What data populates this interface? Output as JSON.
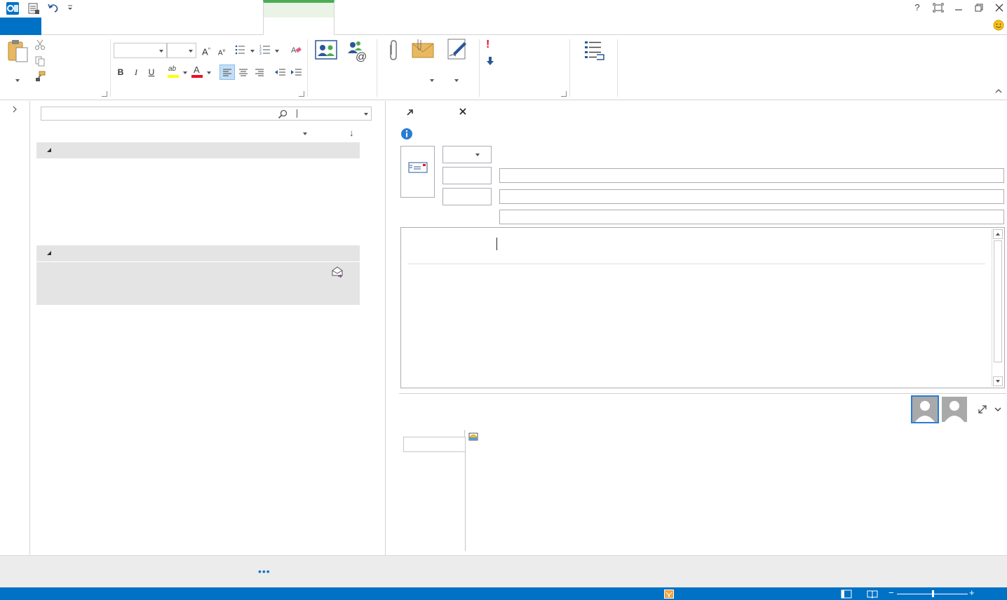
{
  "window": {
    "title": "",
    "help_icon": "question-mark",
    "restore_icon": "restore",
    "minimize_icon": "minimize",
    "maximize_icon": "maximize",
    "close_icon": "close"
  },
  "quick_access": {
    "app_icon": "outlook-logo",
    "send_receive_icon": "send-receive",
    "undo_icon": "undo"
  },
  "tabs": {
    "file_label": "",
    "contextual_label": ""
  },
  "ribbon": {
    "font_name": "",
    "font_size": "",
    "grow_font": "A",
    "shrink_font": "A",
    "bold": "B",
    "italic": "I",
    "underline": "U",
    "font_color_letter": "A",
    "highlight_letters": "ab",
    "importance_high": "!",
    "colors": {
      "accent": "#0072c6",
      "context_green": "#4aad52",
      "font_red": "#e81123",
      "highlight_yellow": "#ffff00",
      "importance_red": "#e81123"
    }
  },
  "search": {
    "placeholder": "",
    "scope": ""
  },
  "message_list": {
    "sort_arrow": "↓",
    "groups": [
      {
        "label": ""
      },
      {
        "label": ""
      }
    ]
  },
  "reading_pane": {
    "popout_icon": "pop-out",
    "discard_icon": "close",
    "info_icon": "info",
    "from_value": "",
    "to_label": "",
    "cc_label": "",
    "to_value": "",
    "cc_value": "",
    "subject_value": "",
    "body_text": ""
  },
  "people_pane": {
    "expand_icon": "expand",
    "collapse_icon": "chevron-down"
  },
  "bottom": {
    "more_dots": "•••"
  },
  "status": {
    "reminders_icon": "reminder",
    "normal_view_icon": "normal-view",
    "reading_view_icon": "reading-view",
    "zoom_minus": "−",
    "zoom_plus": "+",
    "zoom_level": 0.5
  }
}
